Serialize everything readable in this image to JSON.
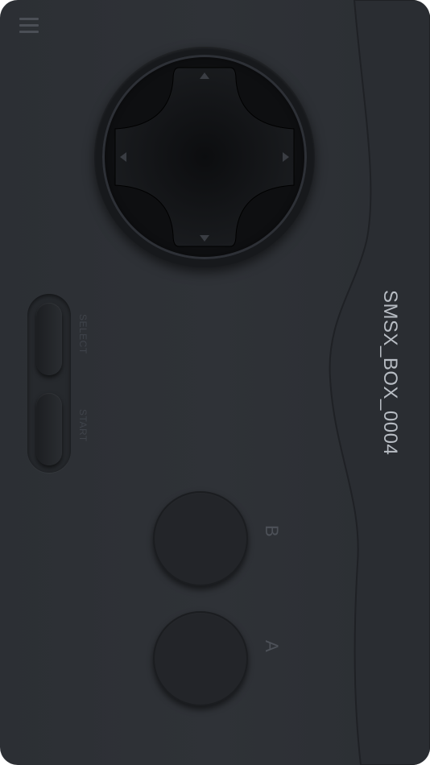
{
  "app": {
    "device_name": "SMSX_BOX_0004"
  },
  "menu": {
    "icon": "hamburger-menu-icon"
  },
  "dpad": {
    "icons": [
      "arrow-up-icon",
      "arrow-down-icon",
      "arrow-left-icon",
      "arrow-right-icon"
    ]
  },
  "controls": {
    "select_label": "SELECT",
    "start_label": "START",
    "b_label": "B",
    "a_label": "A"
  },
  "colors": {
    "body": "#2e3136",
    "button": "#232529",
    "label": "#4d5158",
    "device_text": "#b7bcc3"
  }
}
